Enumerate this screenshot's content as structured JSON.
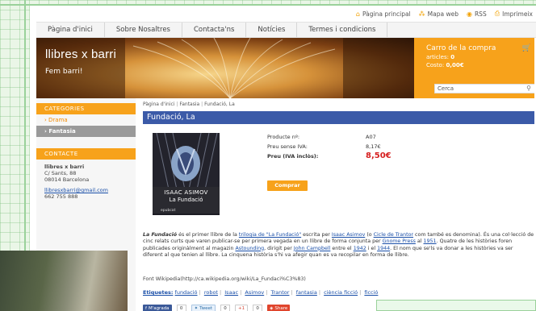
{
  "topbar": {
    "links": [
      {
        "label": "Pàgina principal",
        "icon": "home-icon"
      },
      {
        "label": "Mapa web",
        "icon": "sitemap-icon"
      },
      {
        "label": "RSS",
        "icon": "rss-icon"
      },
      {
        "label": "Imprimeix",
        "icon": "print-icon"
      }
    ]
  },
  "nav": {
    "items": [
      "Pàgina d'inici",
      "Sobre Nosaltres",
      "Contacta'ns",
      "Notícies",
      "Termes i condicions"
    ]
  },
  "banner": {
    "title": "llibres x barri",
    "subtitle": "Fem barri!"
  },
  "cart": {
    "title": "Carro de la compra",
    "items_label": "articles:",
    "items_value": "0",
    "total_label": "Costo:",
    "total_value": "0,00€"
  },
  "search": {
    "placeholder": "Cerca"
  },
  "sidebar": {
    "categories_heading": "CATEGORIES",
    "categories": [
      {
        "label": "Drama",
        "active": false
      },
      {
        "label": "Fantasia",
        "active": true
      }
    ],
    "contact_heading": "CONTACTE",
    "contact": {
      "name": "llibres x barri",
      "street": "C/ Sants, 88",
      "city": "08014 Barcelona",
      "email": "llibresxbarri@gmail.com",
      "phone": "662 755 888"
    }
  },
  "breadcrumb": [
    "Pàgina d'inici",
    "Fantasia",
    "Fundació, La"
  ],
  "product": {
    "title": "Fundació, La",
    "cover_author": "ISAAC ASIMOV",
    "cover_title": "La Fundació",
    "cover_publisher": "epubcat",
    "specs": [
      {
        "label": "Producte nº:",
        "value": "A07"
      },
      {
        "label": "Preu sense IVA:",
        "value": "8,17€"
      },
      {
        "label": "Preu (IVA inclòs):",
        "value": "8,50€"
      }
    ],
    "buy_label": "Comprar"
  },
  "description": {
    "title": "La Fundació",
    "p1": "és el primer llibre de la",
    "link_trilogy": "trilogia de \"La Fundació\"",
    "p2": "escrita per",
    "link_author": "Isaac Asimov",
    "p3": "(o",
    "link_cycle": "Cicle de Trantor",
    "p4": "com també es denomina). És una col·lecció de cinc relats curts que varen publicar-se per primera vegada en un llibre de forma conjunta per",
    "link_press": "Gnome Press",
    "p5": "al",
    "link_1951": "1951",
    "p6": ". Quatre de les històries foren publicades originàlment al magazin",
    "link_astounding": "Astounding",
    "p7": ", dirigit per",
    "link_campbell": "John Campbell",
    "p8": "entre el",
    "link_1942": "1942",
    "p9": "i el",
    "link_1944": "1944",
    "p10": ". El nom que se'ls va donar a les històries va ser diferent al que tenien al llibre. La cinquena història s'hi va afegir quan es va recopilar en forma de llibre.",
    "source": "Font Wikipedia(http://ca.wikipedia.org/wiki/La_Fundaci%C3%83)"
  },
  "tags": {
    "label": "Etiquetes:",
    "items": [
      "fundació",
      "robot",
      "Isaac",
      "Asimov",
      "Trantor",
      "fantasia",
      "ciència ficció",
      "ficció"
    ]
  },
  "share": {
    "facebook_label": "M'agrada",
    "facebook_count": "0",
    "twitter_label": "Tweet",
    "twitter_count": "0",
    "gplus_label": "+1",
    "gplus_count": "0",
    "share_label": "Share"
  },
  "colors": {
    "accent": "#f7a21b",
    "title_bar": "#3b5aa8",
    "price": "#d62020",
    "link": "#1a4fa8"
  }
}
